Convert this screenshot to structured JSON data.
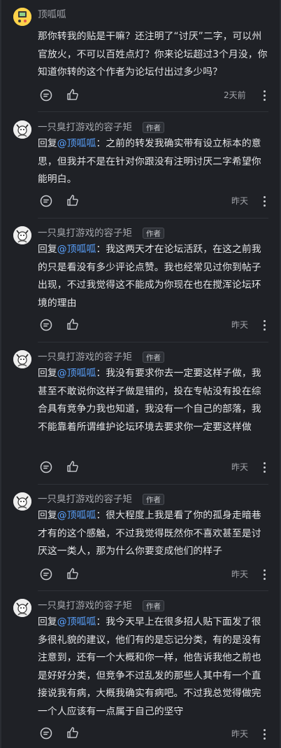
{
  "thread": {
    "comments": [
      {
        "user": "顶呱呱",
        "is_author": false,
        "reply_prefix": "",
        "reply_to": "",
        "text": "那你转我的贴是干嘛？还注明了“讨厌”二字，可以州官放火，不可以百姓点灯？你来论坛超过3个月没，你知道你转的这个作者为论坛付出过多少吗？",
        "time": "2天前",
        "avatar": "yellow-duck-avatar"
      },
      {
        "user": "一只臭打游戏的容子矩",
        "is_author": true,
        "author_tag": "作者",
        "reply_prefix": "回复",
        "reply_to": "@顶呱呱",
        "text": "：之前的转发我确实带有设立标本的意思，但我并不是在针对你跟没有注明讨厌二字希望你能明白。",
        "time": "昨天",
        "avatar": "bw-character-avatar"
      },
      {
        "user": "一只臭打游戏的容子矩",
        "is_author": true,
        "author_tag": "作者",
        "reply_prefix": "回复",
        "reply_to": "@顶呱呱",
        "text": "：我这两天才在论坛活跃，在这之前我的只是看没有多少评论点赞。我也经常见过你到帖子出现，不过我觉得这不能成为你现在也在搅浑论坛环境的理由",
        "time": "昨天",
        "avatar": "bw-character-avatar"
      },
      {
        "user": "一只臭打游戏的容子矩",
        "is_author": true,
        "author_tag": "作者",
        "reply_prefix": "回复",
        "reply_to": "@顶呱呱",
        "text": "：我没有要求你去一定要这样子做，我甚至不敢说你这样子做是错的，投在专帖没有投在综合具有竞争力我也知道，我没有一个自己的部落，我不能靠着所谓维护论坛环境去要求你一定要这样做",
        "time": "昨天",
        "avatar": "bw-character-avatar"
      },
      {
        "user": "一只臭打游戏的容子矩",
        "is_author": true,
        "author_tag": "作者",
        "reply_prefix": "回复",
        "reply_to": "@顶呱呱",
        "text": "：很大程度上我是看了你的孤身走暗巷才有的这个感触，不过我觉得既然你不喜欢甚至是讨厌这一类人，那为什么你要变成他们的样子",
        "time": "昨天",
        "avatar": "bw-character-avatar"
      },
      {
        "user": "一只臭打游戏的容子矩",
        "is_author": true,
        "author_tag": "作者",
        "reply_prefix": "回复",
        "reply_to": "@顶呱呱",
        "text": "：我今天早上在很多招人贴下面发了很多很礼貌的建议，他们有的是忘记分类，有的是没有注意到，还有一个大概和你一样，他告诉我他之前也是好好分类，但竞争不过乱发的那些人其中有一个直接说我有病，大概我确实有病吧。不过我总觉得做完一个人应该有一点属于自己的坚守",
        "time": "昨天",
        "avatar": "bw-character-avatar"
      }
    ]
  },
  "icons": {
    "reply": "comment-bubble-icon",
    "like": "thumbs-up-icon",
    "more": "more-vertical-icon"
  },
  "colors": {
    "background": "#1f2126",
    "mention": "#5aa2ff",
    "text": "#e3e4e6",
    "muted": "#a3a5ab"
  }
}
